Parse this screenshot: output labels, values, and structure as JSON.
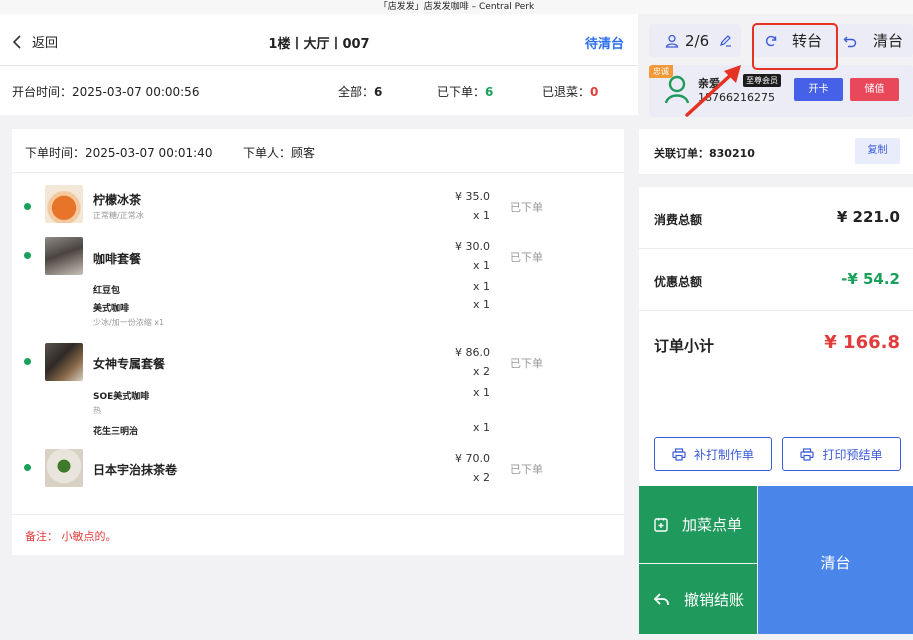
{
  "window_title": "「店发发」店发发咖啡 – Central Perk",
  "header": {
    "back_label": "返回",
    "table_name": "1楼丨大厅丨007",
    "status_label": "待清台"
  },
  "info": {
    "open_time_label": "开台时间：2025-03-07 00:00:56",
    "total_label": "全部：",
    "total_value": "6",
    "ordered_label": "已下单：",
    "ordered_value": "6",
    "returned_label": "已退菜：",
    "returned_value": "0"
  },
  "order": {
    "time_label": "下单时间：2025-03-07 00:01:40",
    "orderer_label": "下单人：顾客",
    "items": [
      {
        "name": "柠檬冰茶",
        "spec": "正常糖/正常冰",
        "price": "¥ 35.0",
        "qty": "x 1",
        "status": "已下单"
      },
      {
        "name": "咖啡套餐",
        "price": "¥ 30.0",
        "qty": "x 1",
        "status": "已下单",
        "subs": [
          {
            "name": "红豆包",
            "qty": "x 1"
          },
          {
            "name": "美式咖啡",
            "qty": "x 1",
            "note": "少冰/加一份浓缩 x1"
          }
        ]
      },
      {
        "name": "女神专属套餐",
        "price": "¥ 86.0",
        "qty": "x 2",
        "status": "已下单",
        "subs": [
          {
            "name": "SOE美式咖啡",
            "qty": "x 1",
            "note": "热"
          },
          {
            "name": "花生三明治",
            "qty": "x 1"
          }
        ]
      },
      {
        "name": "日本宇治抹茶卷",
        "price": "¥ 70.0",
        "qty": "x 2",
        "status": "已下单"
      }
    ],
    "note": "备注： 小敏点的。"
  },
  "right": {
    "guests": "2/6",
    "transfer_label": "转台",
    "clear_label": "清台",
    "member": {
      "tag": "忠诚",
      "name": "亲爱",
      "level": "至尊会员",
      "phone": "18766216275",
      "open_card_label": "开卡",
      "store_value_label": "储值"
    },
    "linked_order_label": "关联订单：830210",
    "copy_label": "复制",
    "summary": {
      "total_label": "消费总额",
      "total_value": "¥ 221.0",
      "discount_label": "优惠总额",
      "discount_value": "-¥ 54.2",
      "subtotal_label": "订单小计",
      "subtotal_value": "¥ 166.8"
    },
    "reprint_label": "补打制作单",
    "print_bill_label": "打印预结单",
    "add_dish_label": "加菜点单",
    "cancel_checkout_label": "撤销结账",
    "clear_table_label": "清台"
  },
  "colors": {
    "accent_blue": "#3b5bd9",
    "green": "#1f9a5c",
    "red": "#e23b3b",
    "highlight_red": "#e53222"
  }
}
